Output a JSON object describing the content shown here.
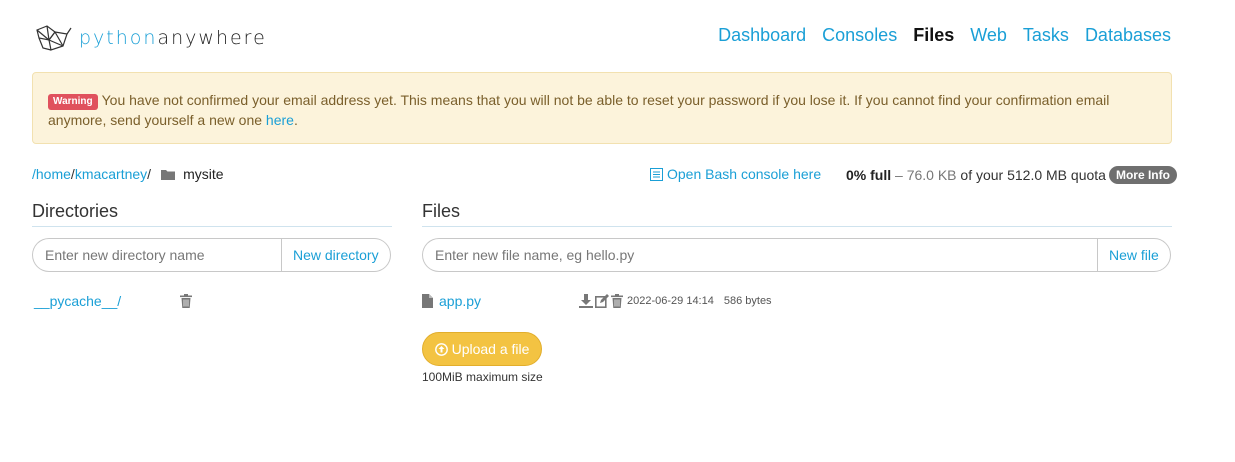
{
  "brand": {
    "part1": "python",
    "part2": "anywhere"
  },
  "nav": [
    {
      "label": "Dashboard",
      "active": false
    },
    {
      "label": "Consoles",
      "active": false
    },
    {
      "label": "Files",
      "active": true
    },
    {
      "label": "Web",
      "active": false
    },
    {
      "label": "Tasks",
      "active": false
    },
    {
      "label": "Databases",
      "active": false
    }
  ],
  "warning": {
    "badge": "Warning",
    "text": "You have not confirmed your email address yet. This means that you will not be able to reset your password if you lose it. If you cannot find your confirmation email anymore, send yourself a new one",
    "link": "here",
    "trailing": "."
  },
  "breadcrumb": {
    "root": "/home",
    "user": "kmacartney",
    "current": "mysite"
  },
  "bash_link": "Open Bash console here",
  "quota": {
    "percent": "0% full",
    "used": "– 76.0 KB",
    "of_text": "of your 512.0 MB quota",
    "more_info": "More Info"
  },
  "directories": {
    "title": "Directories",
    "placeholder": "Enter new directory name",
    "button": "New directory",
    "items": [
      {
        "name": "__pycache__/"
      }
    ]
  },
  "files": {
    "title": "Files",
    "placeholder": "Enter new file name, eg hello.py",
    "button": "New file",
    "items": [
      {
        "name": "app.py",
        "modified": "2022-06-29 14:14",
        "size": "586 bytes"
      }
    ],
    "upload_label": "Upload a file",
    "upload_note": "100MiB maximum size"
  },
  "colors": {
    "accent": "#1a9fd6",
    "warning_bg": "#fcf3db",
    "upload": "#f3c342",
    "badge": "#e0515d"
  }
}
